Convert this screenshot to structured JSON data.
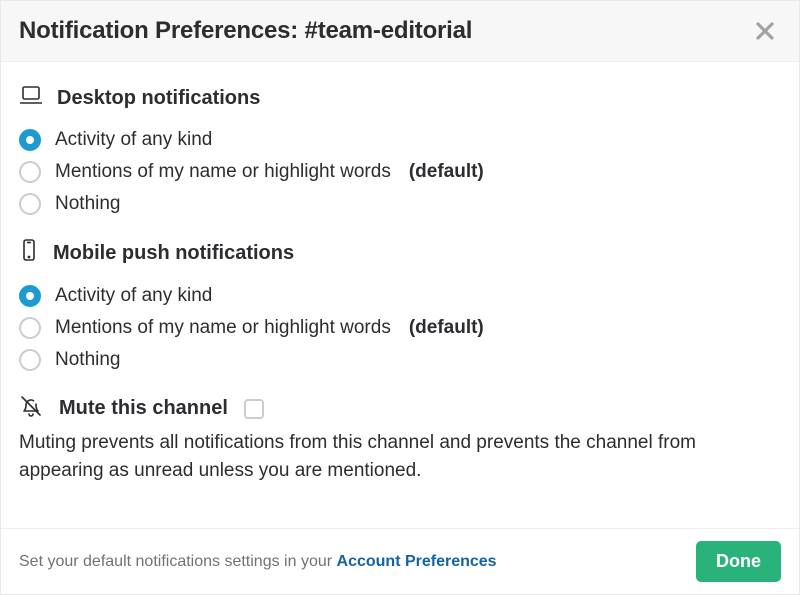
{
  "title_prefix": "Notification Preferences: ",
  "channel_name": "#team-editorial",
  "sections": {
    "desktop": {
      "heading": "Desktop notifications",
      "options": [
        {
          "label": "Activity of any kind",
          "selected": true,
          "is_default": false
        },
        {
          "label": "Mentions of my name or highlight words",
          "selected": false,
          "is_default": true
        },
        {
          "label": "Nothing",
          "selected": false,
          "is_default": false
        }
      ]
    },
    "mobile": {
      "heading": "Mobile push notifications",
      "options": [
        {
          "label": "Activity of any kind",
          "selected": true,
          "is_default": false
        },
        {
          "label": "Mentions of my name or highlight words",
          "selected": false,
          "is_default": true
        },
        {
          "label": "Nothing",
          "selected": false,
          "is_default": false
        }
      ]
    }
  },
  "default_tag": "(default)",
  "mute": {
    "heading": "Mute this channel",
    "checked": false,
    "description": "Muting prevents all notifications from this channel and prevents the channel from appearing as unread unless you are mentioned."
  },
  "footer": {
    "text": "Set your default notifications settings in your ",
    "link_label": "Account Preferences",
    "done_label": "Done"
  }
}
